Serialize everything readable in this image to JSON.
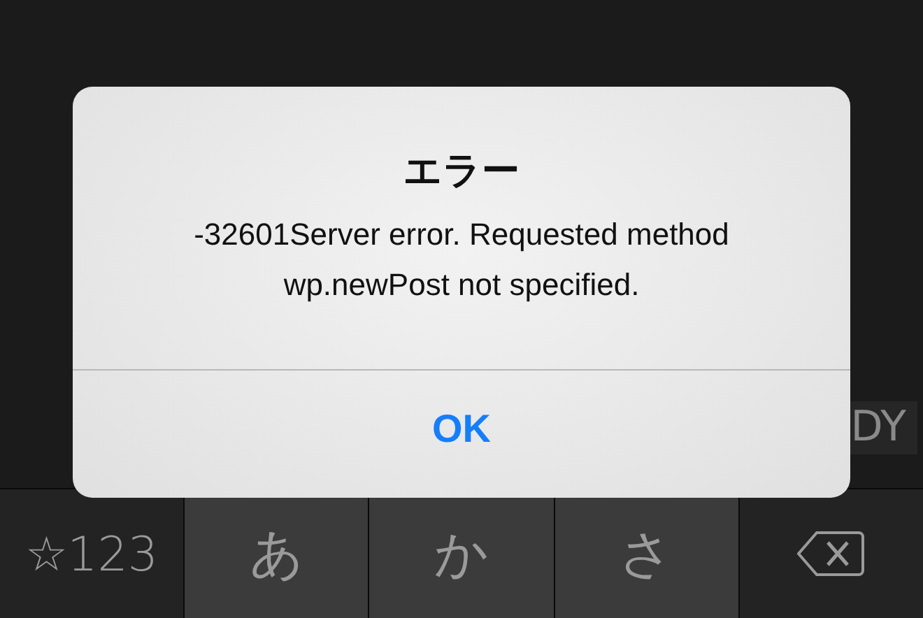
{
  "background_key": {
    "label": "DY"
  },
  "keyboard": {
    "keys": [
      {
        "kind": "function",
        "label": "☆123"
      },
      {
        "kind": "kana",
        "label": "あ"
      },
      {
        "kind": "kana",
        "label": "か"
      },
      {
        "kind": "kana",
        "label": "さ"
      },
      {
        "kind": "delete"
      }
    ]
  },
  "alert": {
    "title": "エラー",
    "message": "-32601Server error. Requested method wp.newPost not specified.",
    "buttons": [
      "OK"
    ]
  }
}
